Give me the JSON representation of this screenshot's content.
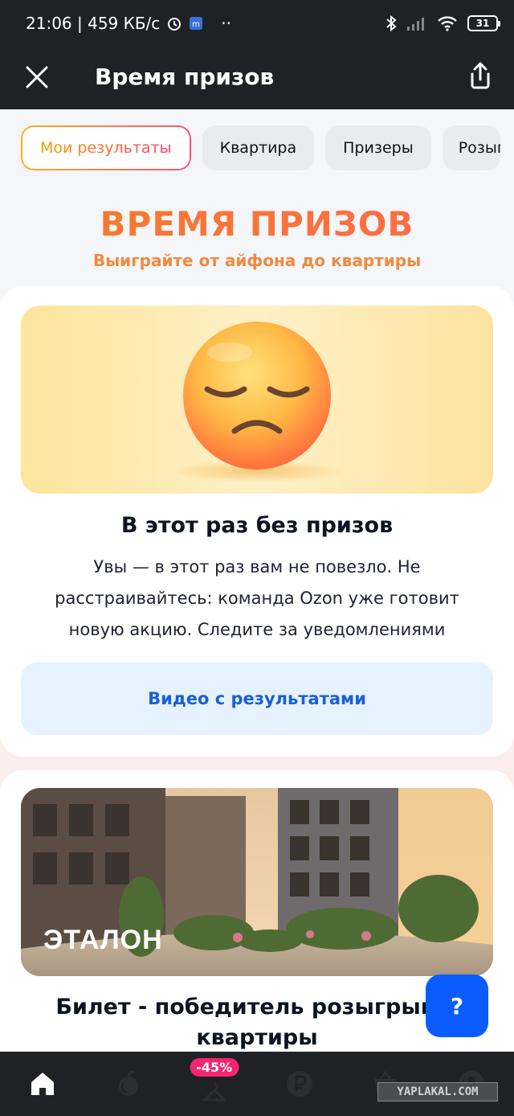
{
  "status_bar": {
    "time_speed": "21:06 | 459 КБ/с",
    "dots": "··",
    "battery": "31"
  },
  "header": {
    "title": "Время призов",
    "close_icon": "close-icon",
    "share_icon": "share-icon"
  },
  "tabs": [
    {
      "label": "Мои результаты",
      "active": true
    },
    {
      "label": "Квартира",
      "active": false
    },
    {
      "label": "Призеры",
      "active": false
    },
    {
      "label": "Розыгрыш",
      "active": false
    }
  ],
  "hero": {
    "title": "ВРЕМЯ ПРИЗОВ",
    "subtitle": "Выиграйте от айфона до квартиры"
  },
  "result_card": {
    "emoji": "pensive-face",
    "title": "В этот раз без призов",
    "text": "Увы — в этот раз вам не повезло. Не расстраивайтесь: команда Ozon уже готовит новую акцию. Следите за уведомлениями",
    "button_label": "Видео с результатами"
  },
  "ticket_card": {
    "brand": "ЭТАЛОН",
    "title": "Билет - победитель розыгрыша квартиры"
  },
  "help_button": {
    "label": "?"
  },
  "bottom_nav": {
    "items": [
      {
        "icon": "home-icon"
      },
      {
        "icon": "fresh-icon"
      },
      {
        "icon": "sale-icon",
        "badge": "-45%"
      },
      {
        "icon": "ruble-icon"
      },
      {
        "icon": "cart-icon"
      },
      {
        "icon": "profile-icon"
      }
    ]
  },
  "watermark": "YAPLAKAL.COM",
  "colors": {
    "dark_bar": "#1f2127",
    "accent_orange": "#f57d2a",
    "button_blue": "#0a5cff",
    "link_blue": "#1a5fd6",
    "badge_pink": "#f5246e"
  }
}
